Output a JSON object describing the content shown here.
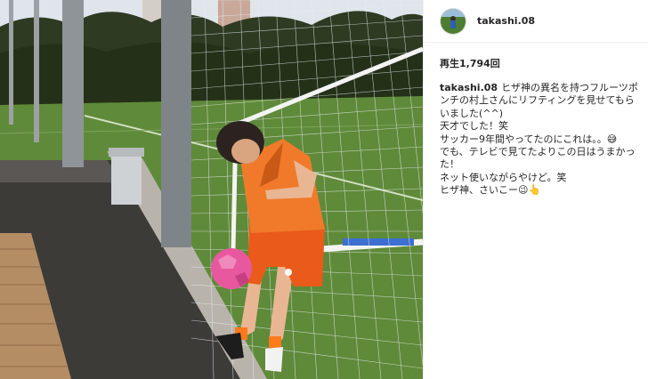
{
  "post": {
    "username": "takashi.08",
    "views_label": "再生1,794回",
    "caption_lines": [
      "ヒザ神の異名を持つフルーツポンチの村上さんにリフティングを見せてもらいました(^^)",
      "天才でした！笑",
      "サッカー9年間やってたのにこれは。。😅",
      "でも、テレビで見てたよりこの日はうまかった！",
      "ネット使いながらやけど。笑",
      "ヒザ神、さいこー😉👆"
    ]
  },
  "media": {
    "type": "video",
    "icons": [
      "soccer-ball-icon"
    ],
    "colors": {
      "shirt": "#f07a2a",
      "shorts": "#ea5a1a",
      "ball": "#e8589e",
      "field": "#5f8a3a",
      "sky": "#dfe5ea"
    }
  }
}
